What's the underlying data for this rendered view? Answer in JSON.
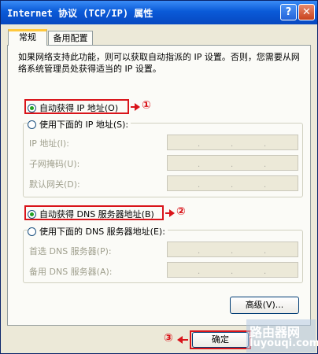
{
  "window": {
    "title": "Internet 协议 (TCP/IP) 属性",
    "help_label": "?",
    "close_label": "✕"
  },
  "tabs": [
    {
      "label": "常规"
    },
    {
      "label": "备用配置"
    }
  ],
  "description": "如果网络支持此功能，则可以获取自动指派的 IP 设置。否则，您需要从网络系统管理员处获得适当的 IP 设置。",
  "ip": {
    "auto_label": "自动获得 IP 地址(O)",
    "manual_label": "使用下面的 IP 地址(S):",
    "auto_selected": true,
    "fields": [
      {
        "label": "IP 地址(I):"
      },
      {
        "label": "子网掩码(U):"
      },
      {
        "label": "默认网关(D):"
      }
    ]
  },
  "dns": {
    "auto_label": "自动获得 DNS 服务器地址(B)",
    "manual_label": "使用下面的 DNS 服务器地址(E):",
    "auto_selected": true,
    "fields": [
      {
        "label": "首选 DNS 服务器(P):"
      },
      {
        "label": "备用 DNS 服务器(A):"
      }
    ]
  },
  "buttons": {
    "advanced": "高级(V)...",
    "ok": "确定"
  },
  "annotations": {
    "one": "①",
    "two": "②",
    "three": "③"
  },
  "watermark": {
    "line1": "路由器网",
    "line2": "luyouqi.com"
  },
  "colors": {
    "annotation": "#d9141a",
    "titlebar": "#0a5ad8",
    "radio_dot": "#21a121"
  }
}
